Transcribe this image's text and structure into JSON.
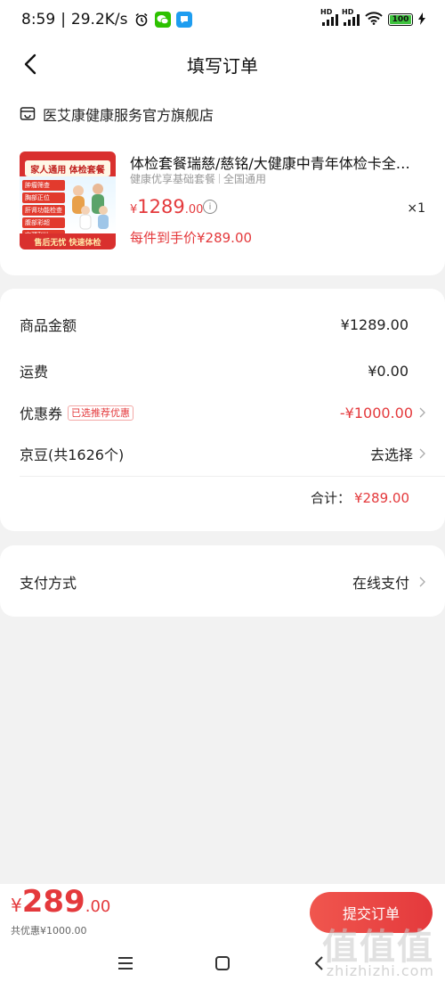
{
  "status_bar": {
    "time": "8:59",
    "speed": "29.2K/s",
    "battery": "100"
  },
  "header": {
    "title": "填写订单"
  },
  "store": {
    "name": "医艾康健康服务官方旗舰店"
  },
  "product": {
    "image_title": "家人通用 体检套餐",
    "image_items": [
      "肿瘤筛查",
      "胸部正位",
      "肝肾功能检查",
      "腹部彩超",
      "宫颈刮片"
    ],
    "image_footer": "售后无忧 快速体检",
    "name": "体检套餐瑞慈/慈铭/大健康中青年体检卡全面...",
    "tag1": "健康优享基础套餐",
    "tag2": "全国通用",
    "price_yen": "¥",
    "price_int": "1289",
    "price_dec": ".00",
    "quantity": "×1",
    "unit_price": "每件到手价¥289.00"
  },
  "fees": {
    "goods_label": "商品金额",
    "goods_value": "¥1289.00",
    "shipping_label": "运费",
    "shipping_value": "¥0.00",
    "coupon_label": "优惠券",
    "coupon_tag": "已选推荐优惠",
    "coupon_value": "-¥1000.00",
    "jingdou_label": "京豆(共1626个)",
    "jingdou_value": "去选择",
    "total_label": "合计：",
    "total_value": "¥289.00"
  },
  "payment": {
    "label": "支付方式",
    "value": "在线支付"
  },
  "bottom": {
    "total_yen": "¥",
    "total_int": "289",
    "total_dec": ".00",
    "saved": "共优惠¥1000.00",
    "submit_label": "提交订单",
    "watermark": "值值值",
    "watermark_url": "zhizhizhi.com"
  },
  "colors": {
    "accent": "#e4393c",
    "background": "#f2f2f2"
  }
}
